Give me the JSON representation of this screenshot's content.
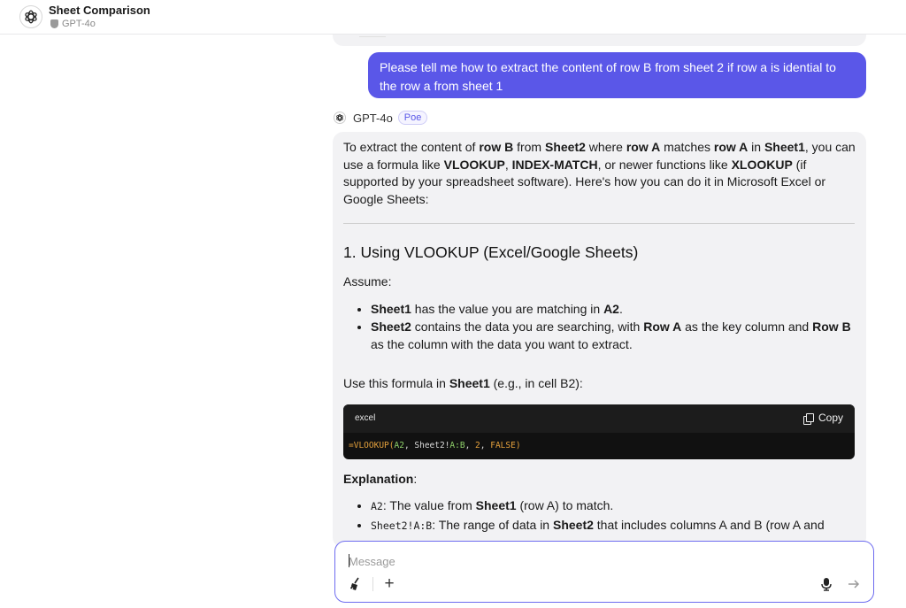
{
  "header": {
    "title": "Sheet Comparison",
    "model": "GPT-4o"
  },
  "user_message": "Please tell me how to extract the content of row B from sheet 2 if row a is idential to the row a from sheet 1",
  "bot": {
    "name": "GPT-4o",
    "badge": "Poe"
  },
  "answer": {
    "intro": {
      "p1": "To extract the content of ",
      "b1": "row B",
      "p2": " from ",
      "b2": "Sheet2",
      "p3": " where ",
      "b3": "row A",
      "p4": " matches ",
      "b4": "row A",
      "p5": " in ",
      "b5": "Sheet1",
      "p6": ", you can use a formula like ",
      "b6": "VLOOKUP",
      "p7": ", ",
      "b7": "INDEX-MATCH",
      "p8": ", or newer functions like ",
      "b8": "XLOOKUP",
      "p9": " (if supported by your spreadsheet software). Here's how you can do it in Microsoft Excel or Google Sheets:"
    },
    "section_heading": "1. Using VLOOKUP (Excel/Google Sheets)",
    "assume": "Assume:",
    "bullets": [
      {
        "b": "Sheet1",
        "t1": " has the value you are matching in ",
        "b2": "A2",
        "t2": ".",
        "b3": "",
        "t3": ""
      },
      {
        "b": "Sheet2",
        "t1": " contains the data you are searching, with ",
        "b2": "Row A",
        "t2": " as the key column and ",
        "b3": "Row B",
        "t3": " as the column with the data you want to extract."
      }
    ],
    "use_text": {
      "p1": "Use this formula in ",
      "b1": "Sheet1",
      "p2": " (e.g., in cell B2):"
    },
    "code": {
      "lang": "excel",
      "copy_label": "Copy",
      "tokens": {
        "fn": "=VLOOKUP(",
        "ref1": "A2",
        "sep1": ", Sheet2!",
        "ref2": "A:B",
        "sep2": ", ",
        "num": "2",
        "sep3": ", ",
        "kw": "FALSE",
        "close": ")"
      }
    },
    "explanation_heading": "Explanation",
    "explanation_colon": ":",
    "explanation_items": [
      {
        "code": "A2",
        "t1": ": The value from ",
        "b": "Sheet1",
        "t2": " (row A) to match."
      },
      {
        "code": "Sheet2!A:B",
        "t1": ": The range of data in ",
        "b": "Sheet2",
        "t2": " that includes columns A and B (row A and"
      }
    ]
  },
  "composer": {
    "placeholder": "Message"
  }
}
